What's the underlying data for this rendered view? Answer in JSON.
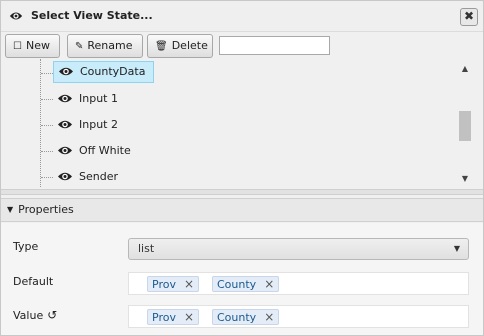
{
  "dialog": {
    "title": "Select View State...",
    "close_label": "✖"
  },
  "toolbar": {
    "new_label": "New",
    "rename_label": "Rename",
    "delete_label": "Delete",
    "name_input_value": ""
  },
  "tree": {
    "items": [
      {
        "label": "CountyData",
        "selected": true
      },
      {
        "label": "Input 1",
        "selected": false
      },
      {
        "label": "Input 2",
        "selected": false
      },
      {
        "label": "Off White",
        "selected": false
      },
      {
        "label": "Sender",
        "selected": false
      }
    ]
  },
  "properties": {
    "header": "Properties",
    "type_label": "Type",
    "type_value": "list",
    "default_label": "Default",
    "default_tags": [
      "Prov",
      "County"
    ],
    "value_label": "Value",
    "value_tags": [
      "Prov",
      "County"
    ]
  },
  "colors": {
    "selected_bg": "#c9ecfb",
    "tag_bg": "#e4edf7",
    "tag_text": "#1c5a8f"
  }
}
